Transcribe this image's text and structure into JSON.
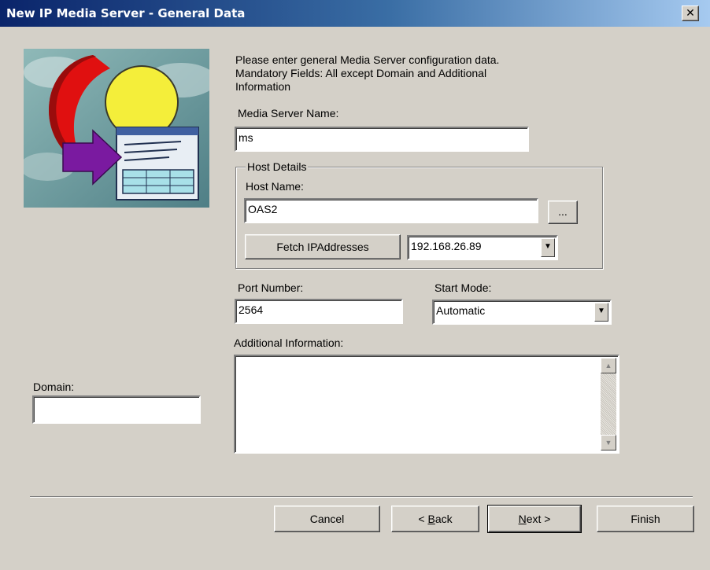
{
  "window": {
    "title": "New IP Media Server - General Data",
    "close_glyph": "✕"
  },
  "intro": {
    "line1": "Please enter general Media Server configuration data.",
    "line2": "Mandatory Fields: All except Domain and Additional",
    "line3": "Information"
  },
  "media_server_name": {
    "label": "Media Server Name:",
    "value": "ms"
  },
  "host_details": {
    "group_label": "Host Details",
    "host_name_label": "Host Name:",
    "host_name_value": "OAS2",
    "browse_label": "...",
    "fetch_label": "Fetch IPAddresses",
    "ip_selected": "192.168.26.89"
  },
  "port": {
    "label": "Port Number:",
    "value": "2564"
  },
  "start_mode": {
    "label": "Start Mode:",
    "selected": "Automatic"
  },
  "additional_info": {
    "label": "Additional Information:",
    "value": ""
  },
  "domain": {
    "label": "Domain:",
    "value": ""
  },
  "footer": {
    "cancel_label": "Cancel",
    "back_prefix": "< ",
    "back_key": "B",
    "back_rest": "ack",
    "next_key": "N",
    "next_rest": "ext >",
    "finish_label": "Finish"
  },
  "icons": {
    "logo": "media-server-wizard-logo",
    "combo_arrow": "triangle-down",
    "scroll_up": "triangle-up",
    "scroll_down": "triangle-down"
  },
  "colors": {
    "dialog_bg": "#d4d0c8",
    "title_start": "#0a246a",
    "title_end": "#a6caf0"
  }
}
